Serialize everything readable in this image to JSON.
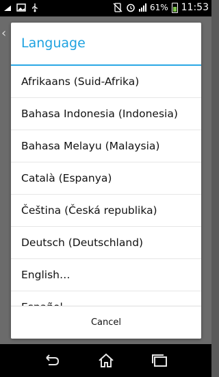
{
  "status_bar": {
    "battery_percent": "61%",
    "time": "11:53",
    "icons": [
      "usb-debug-icon",
      "image-icon",
      "usb-icon",
      "no-sim-icon",
      "alarm-icon",
      "signal-icon",
      "battery-icon"
    ]
  },
  "dialog": {
    "title": "Language",
    "items": [
      "Afrikaans (Suid-Afrika)",
      "Bahasa Indonesia (Indonesia)",
      "Bahasa Melayu (Malaysia)",
      "Català (Espanya)",
      "Čeština (Česká republika)",
      "Deutsch (Deutschland)",
      "English…",
      "Español"
    ],
    "cancel_label": "Cancel"
  },
  "nav_bar": {
    "icons": [
      "back-icon",
      "home-icon",
      "recent-apps-icon"
    ]
  },
  "colors": {
    "accent": "#1ea2e0",
    "status_bar_bg": "#000000",
    "dialog_bg": "#ffffff",
    "scrim": "#5a5a5a"
  }
}
